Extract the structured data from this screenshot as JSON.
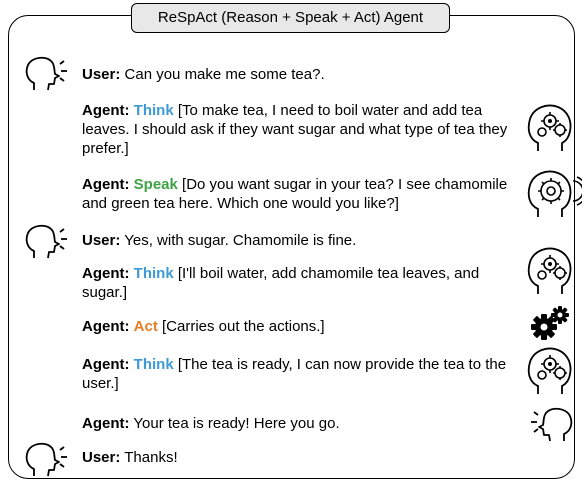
{
  "title": "ReSpAct (Reason + Speak + Act) Agent",
  "icons": {
    "user": "user-speaking-icon",
    "reason": "head-with-gears-icon",
    "speak": "head-with-gear-speaking-icon",
    "act": "gears-icon",
    "agent_speak": "agent-speaking-icon"
  },
  "colors": {
    "think": "#3d9ad6",
    "speak": "#3fa343",
    "act": "#e67e22"
  },
  "turns": [
    {
      "speaker": "User:",
      "text": " Can you make me some tea?."
    },
    {
      "speaker": "Agent:",
      "tag": "Think",
      "text": " [To make tea, I need to boil water and add tea leaves. I should ask if they want sugar and what type of tea they prefer.]"
    },
    {
      "speaker": "Agent:",
      "tag": "Speak",
      "text": " [Do you want sugar in your tea? I see chamomile and green tea here. Which one would you like?]"
    },
    {
      "speaker": "User:",
      "text": " Yes, with sugar. Chamomile is fine."
    },
    {
      "speaker": "Agent:",
      "tag": "Think",
      "text": " [I'll boil water, add chamomile tea leaves, and sugar.]"
    },
    {
      "speaker": "Agent:",
      "tag": "Act",
      "text": " [Carries out the actions.]"
    },
    {
      "speaker": "Agent:",
      "tag": "Think",
      "text": " [The tea is ready, I can now provide the tea to the user.]"
    },
    {
      "speaker": "Agent:",
      "text": " Your tea is ready! Here you go."
    },
    {
      "speaker": "User:",
      "text": " Thanks!"
    }
  ]
}
